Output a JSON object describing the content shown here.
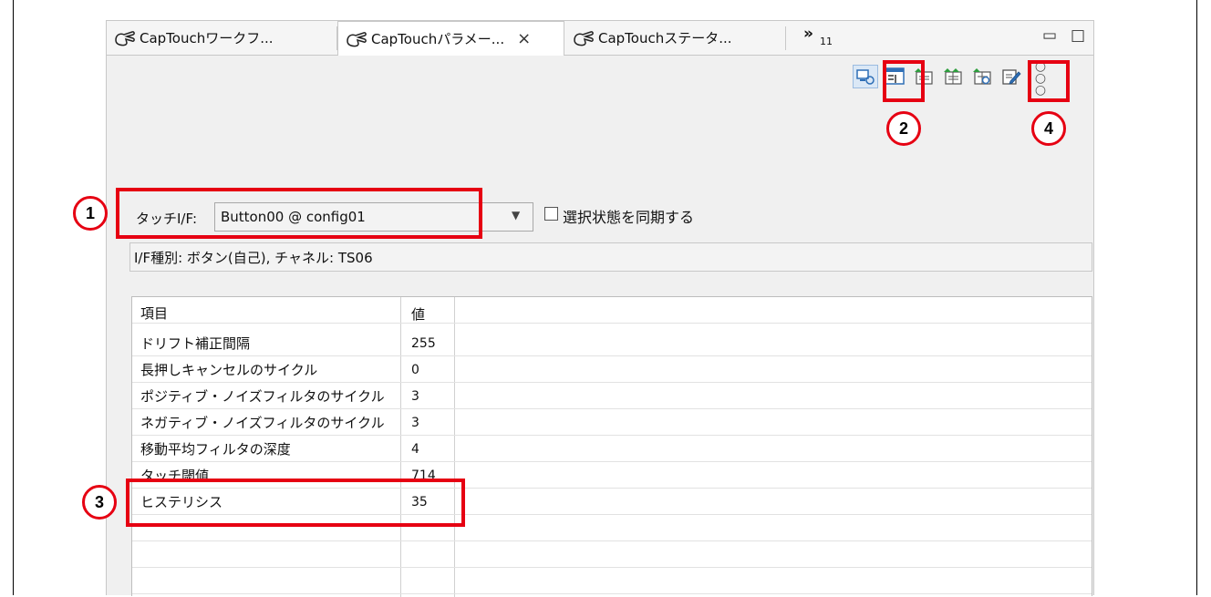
{
  "tabs": [
    {
      "label": "CapTouchワークフ..."
    },
    {
      "label": "CapTouchパラメー...",
      "close": "×"
    },
    {
      "label": "CapTouchステータ..."
    }
  ],
  "overflow": {
    "chevron": "»",
    "count": "11"
  },
  "window_controls": {
    "minimize": "▭",
    "maximize": "□"
  },
  "toolbar_icons": [
    "monitor-icon",
    "parameter-list-icon",
    "upload-icon",
    "upload-all-icon",
    "refresh-icon",
    "edit-icon"
  ],
  "touch_if": {
    "label": "タッチI/F:",
    "value": "Button00 @ config01",
    "dropdown": "▼"
  },
  "sync": {
    "label": "選択状態を同期する",
    "checked": false
  },
  "info_line": "I/F種別: ボタン(自己), チャネル: TS06",
  "table": {
    "headers": [
      "項目",
      "値"
    ],
    "rows": [
      {
        "item": "ドリフト補正間隔",
        "value": "255"
      },
      {
        "item": "長押しキャンセルのサイクル",
        "value": "0"
      },
      {
        "item": "ポジティブ・ノイズフィルタのサイクル",
        "value": "3"
      },
      {
        "item": "ネガティブ・ノイズフィルタのサイクル",
        "value": "3"
      },
      {
        "item": "移動平均フィルタの深度",
        "value": "4"
      },
      {
        "item": "タッチ閾値",
        "value": "714"
      },
      {
        "item": "ヒステリシス",
        "value": "35"
      }
    ]
  },
  "callouts": [
    "1",
    "2",
    "3",
    "4"
  ],
  "colors": {
    "highlight": "#e60012",
    "panel": "#f0f0f0"
  }
}
